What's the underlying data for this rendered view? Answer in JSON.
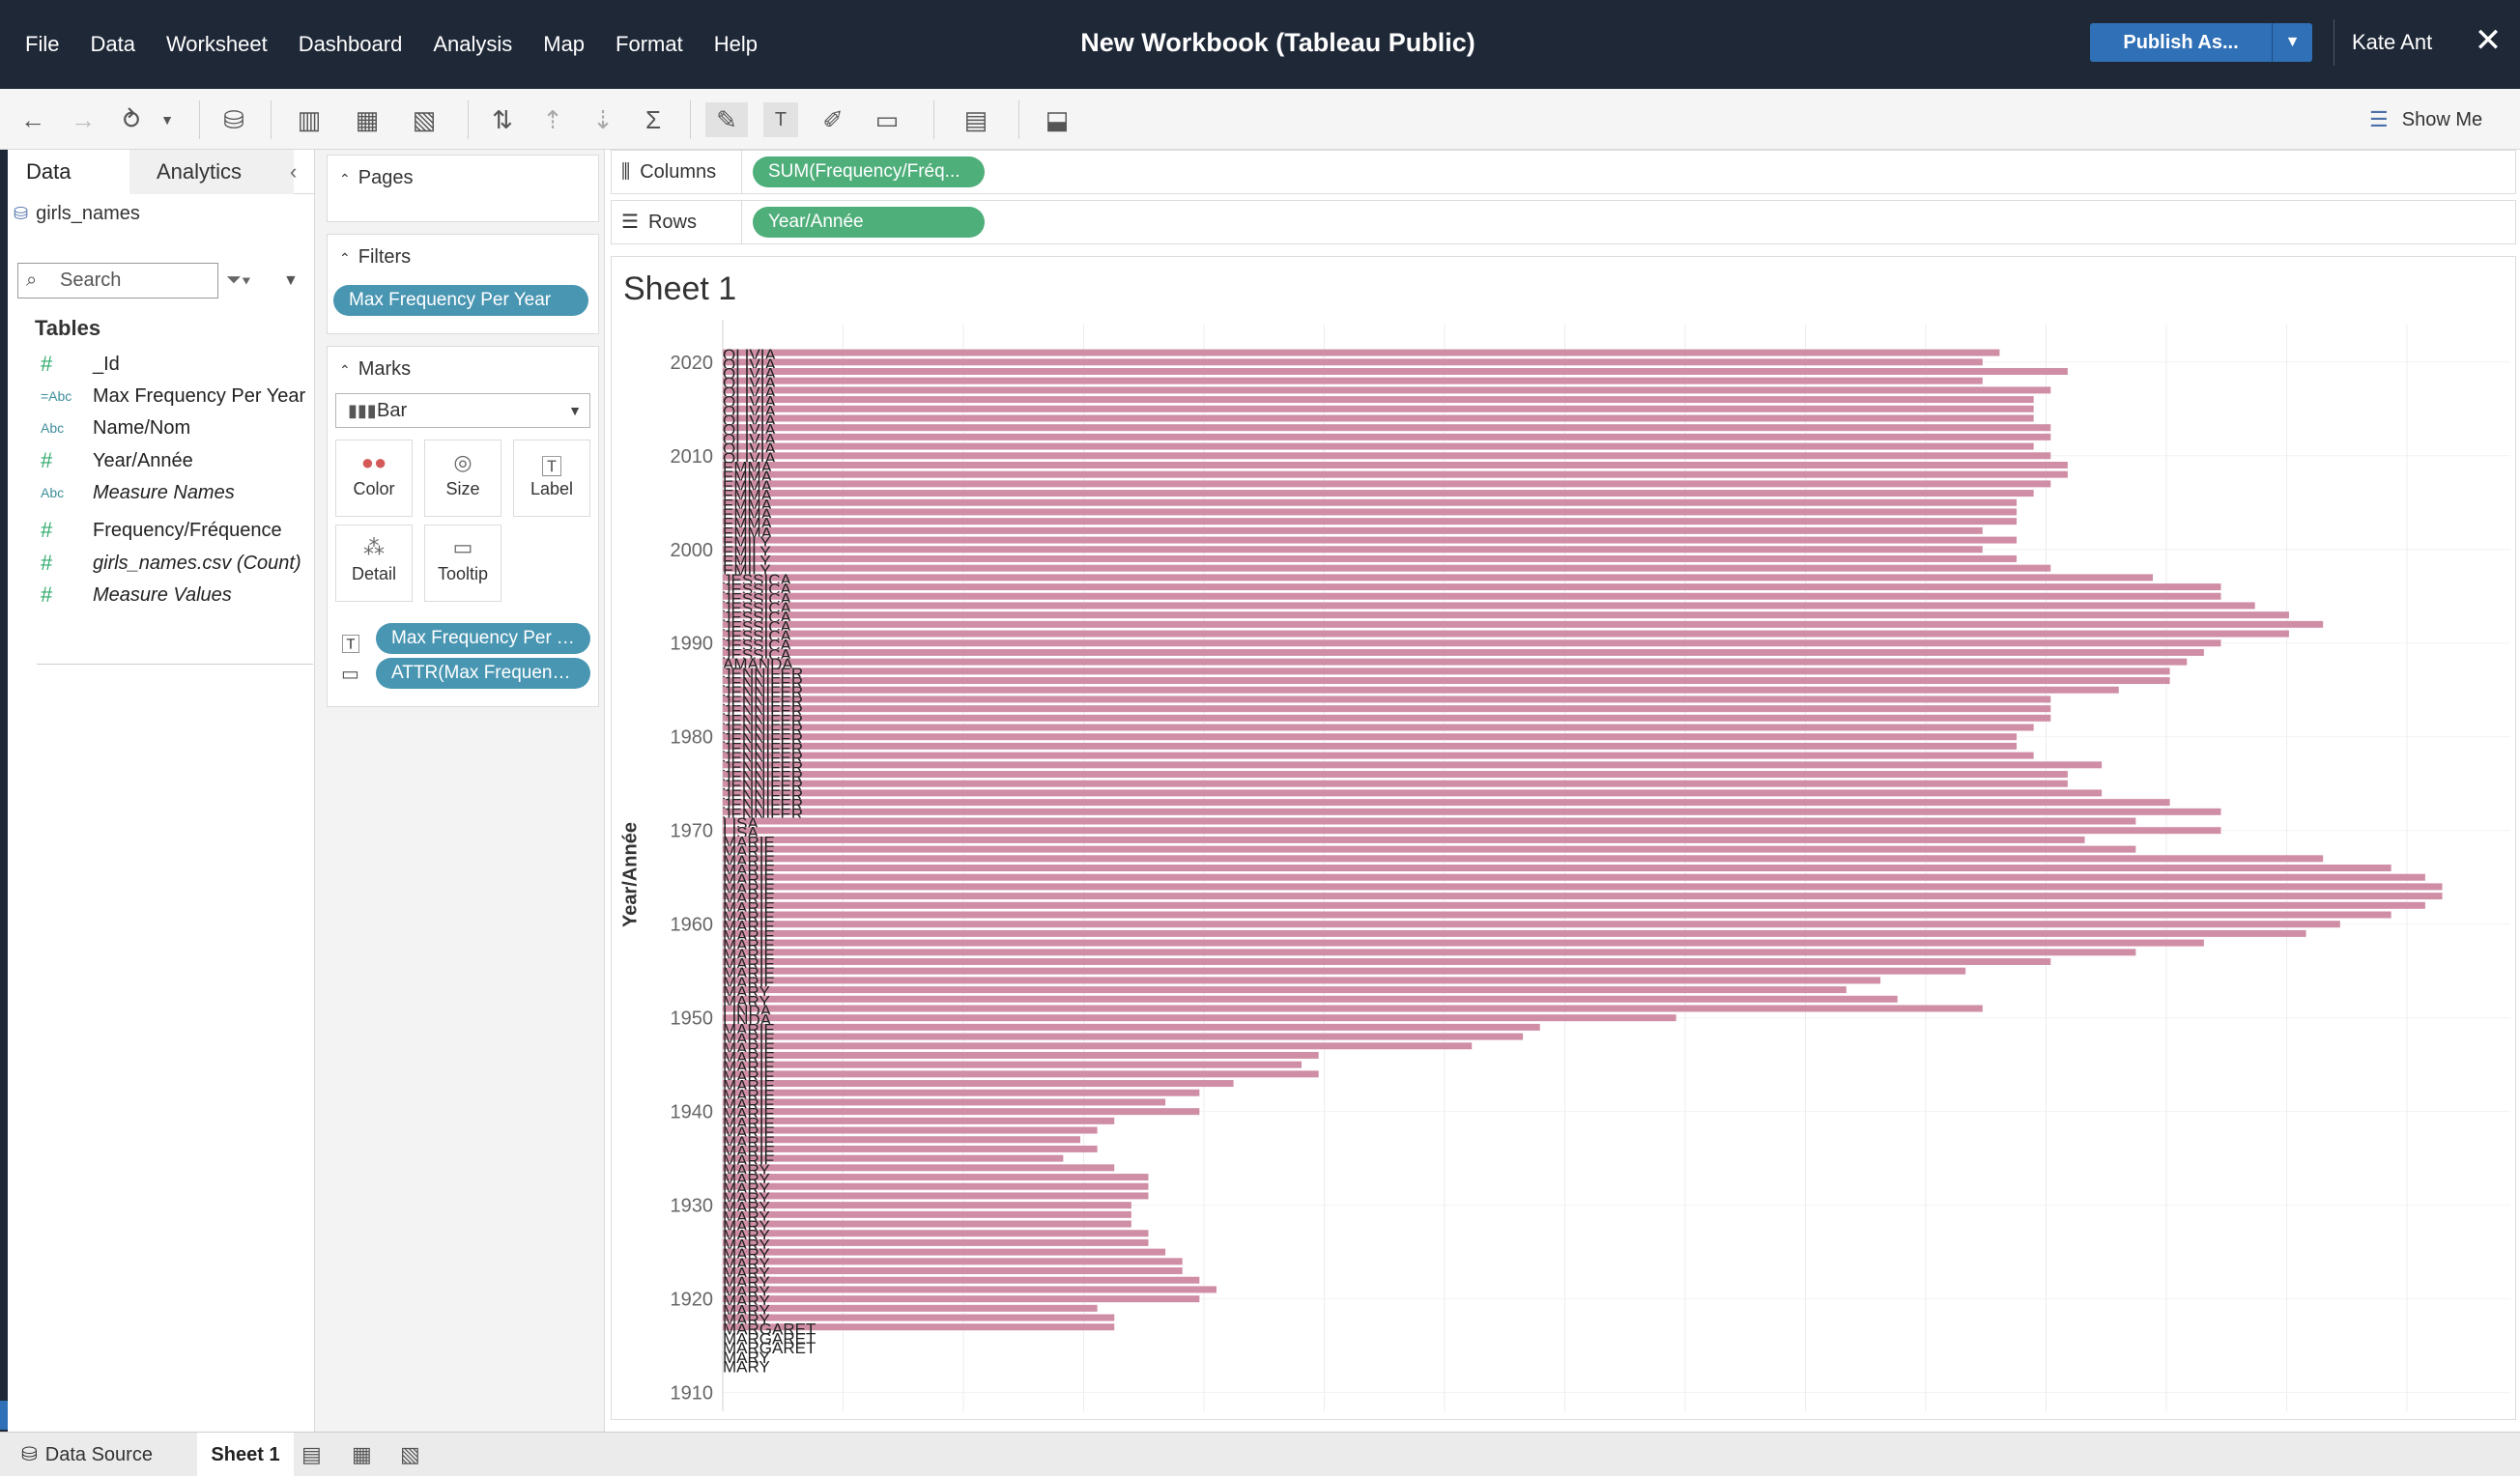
{
  "window": {
    "title": "New Workbook (Tableau Public)",
    "user": "Kate Ant",
    "publish_label": "Publish As..."
  },
  "menu": [
    "File",
    "Data",
    "Worksheet",
    "Dashboard",
    "Analysis",
    "Map",
    "Format",
    "Help"
  ],
  "toolbar": {
    "show_me": "Show Me"
  },
  "data_pane": {
    "tabs": {
      "data": "Data",
      "analytics": "Analytics"
    },
    "datasource": "girls_names",
    "search_placeholder": "Search",
    "tables_heading": "Tables",
    "fields": [
      {
        "icon": "#",
        "name": "_Id"
      },
      {
        "icon": "=Abc",
        "name": "Max Frequency Per Year"
      },
      {
        "icon": "Abc",
        "name": "Name/Nom"
      },
      {
        "icon": "#",
        "name": "Year/Année"
      },
      {
        "icon": "Abc",
        "name": "Measure Names"
      },
      {
        "icon": "#",
        "name": "Frequency/Fréquence"
      },
      {
        "icon": "#",
        "name": "girls_names.csv (Count)"
      },
      {
        "icon": "#",
        "name": "Measure Values"
      }
    ]
  },
  "shelves": {
    "pages": "Pages",
    "filters": "Filters",
    "filter_pill": "Max Frequency Per Year",
    "marks": "Marks",
    "mark_type": "Bar",
    "mark_buttons": [
      "Color",
      "Size",
      "Label",
      "Detail",
      "Tooltip"
    ],
    "mark_pills": [
      "Max Frequency Per Y...",
      "ATTR(Max Frequenc..."
    ],
    "columns_label": "Columns",
    "columns_pill": "SUM(Frequency/Fréq...",
    "rows_label": "Rows",
    "rows_pill": "Year/Année"
  },
  "sheet": {
    "title": "Sheet 1",
    "y_axis_title": "Year/Année"
  },
  "bottom_tabs": {
    "datasource": "Data Source",
    "sheet": "Sheet 1"
  },
  "chart_data": {
    "type": "bar",
    "orientation": "horizontal",
    "bar_color": "#d08ea6",
    "y_ticks": [
      2020,
      2010,
      2000,
      1990,
      1980,
      1970,
      1960,
      1950,
      1940,
      1930,
      1920,
      1910
    ],
    "y_range": [
      1908,
      2024
    ],
    "x_range": [
      0,
      10500
    ],
    "grid": true,
    "series": [
      {
        "x": [
          2021,
          2020,
          2019,
          2018,
          2017,
          2016,
          2015,
          2014,
          2013,
          2012,
          2011,
          2010,
          2009,
          2008,
          2007,
          2006,
          2005,
          2004,
          2003,
          2002,
          2001,
          2000,
          1999,
          1998,
          1997,
          1996,
          1995,
          1994,
          1993,
          1992,
          1991,
          1990,
          1989,
          1988,
          1987,
          1986,
          1985,
          1984,
          1983,
          1982,
          1981,
          1980,
          1979,
          1978,
          1977,
          1976,
          1975,
          1974,
          1973,
          1972,
          1971,
          1970,
          1969,
          1968,
          1967,
          1966,
          1965,
          1964,
          1963,
          1962,
          1961,
          1960,
          1959,
          1958,
          1957,
          1956,
          1955,
          1954,
          1953,
          1952,
          1951,
          1950,
          1949,
          1948,
          1947,
          1946,
          1945,
          1944,
          1943,
          1942,
          1941,
          1940,
          1939,
          1938,
          1937,
          1936,
          1935,
          1934,
          1933,
          1932,
          1931,
          1930,
          1929,
          1928,
          1927,
          1926,
          1925,
          1924,
          1923,
          1922,
          1921,
          1920,
          1919,
          1918,
          1917,
          1916,
          1915,
          1914,
          1913
        ],
        "values": [
          7500,
          7400,
          7900,
          7400,
          7800,
          7700,
          7700,
          7700,
          7800,
          7800,
          7700,
          7800,
          7900,
          7900,
          7800,
          7700,
          7600,
          7600,
          7600,
          7400,
          7600,
          7400,
          7600,
          7800,
          8400,
          8800,
          8800,
          9000,
          9200,
          9400,
          9200,
          8800,
          8700,
          8600,
          8500,
          8500,
          8200,
          7800,
          7800,
          7800,
          7700,
          7600,
          7600,
          7700,
          8100,
          7900,
          7900,
          8100,
          8500,
          8800,
          8300,
          8800,
          8000,
          8300,
          9400,
          9800,
          10000,
          10100,
          10100,
          10000,
          9800,
          9500,
          9300,
          8700,
          8300,
          7800,
          7300,
          6800,
          6600,
          6900,
          7400,
          5600,
          4800,
          4700,
          4400,
          3500,
          3400,
          3500,
          3000,
          2800,
          2600,
          2800,
          2300,
          2200,
          2100,
          2200,
          2000,
          2300,
          2500,
          2500,
          2500,
          2400,
          2400,
          2400,
          2500,
          2500,
          2600,
          2700,
          2700,
          2800,
          2900,
          2800,
          2200,
          2300,
          2300,
          0,
          0,
          0,
          0
        ],
        "labels": [
          "OLIVIA",
          "OLIVIA",
          "OLIVIA",
          "OLIVIA",
          "OLIVIA",
          "OLIVIA",
          "OLIVIA",
          "OLIVIA",
          "OLIVIA",
          "OLIVIA",
          "OLIVIA",
          "OLIVIA",
          "EMMA",
          "EMMA",
          "EMMA",
          "EMMA",
          "EMMA",
          "EMMA",
          "EMMA",
          "EMMA",
          "EMILY",
          "EMILY",
          "EMILY",
          "EMILY",
          "JESSICA",
          "JESSICA",
          "JESSICA",
          "JESSICA",
          "JESSICA",
          "JESSICA",
          "JESSICA",
          "JESSICA",
          "JESSICA",
          "AMANDA",
          "JENNIFER",
          "JENNIFER",
          "JENNIFER",
          "JENNIFER",
          "JENNIFER",
          "JENNIFER",
          "JENNIFER",
          "JENNIFER",
          "JENNIFER",
          "JENNIFER",
          "JENNIFER",
          "JENNIFER",
          "JENNIFER",
          "JENNIFER",
          "JENNIFER",
          "JENNIFER",
          "LISA",
          "LISA",
          "MARIE",
          "MARIE",
          "MARIE",
          "MARIE",
          "MARIE",
          "MARIE",
          "MARIE",
          "MARIE",
          "MARIE",
          "MARIE",
          "MARIE",
          "MARIE",
          "MARIE",
          "MARIE",
          "MARIE",
          "MARIE",
          "MARY",
          "MARY",
          "LINDA",
          "LINDA",
          "MARIE",
          "MARIE",
          "MARIE",
          "MARIE",
          "MARIE",
          "MARIE",
          "MARIE",
          "MARIE",
          "MARIE",
          "MARIE",
          "MARIE",
          "MARIE",
          "MARIE",
          "MARIE",
          "MARIE",
          "MARY",
          "MARY",
          "MARY",
          "MARY",
          "MARY",
          "MARY",
          "MARY",
          "MARY",
          "MARY",
          "MARY",
          "MARY",
          "MARY",
          "MARY",
          "MARY",
          "MARY",
          "MARY",
          "MARY",
          "MARGARET",
          "MARGARET",
          "MARGARET",
          "MARY",
          "MARY"
        ]
      }
    ]
  }
}
